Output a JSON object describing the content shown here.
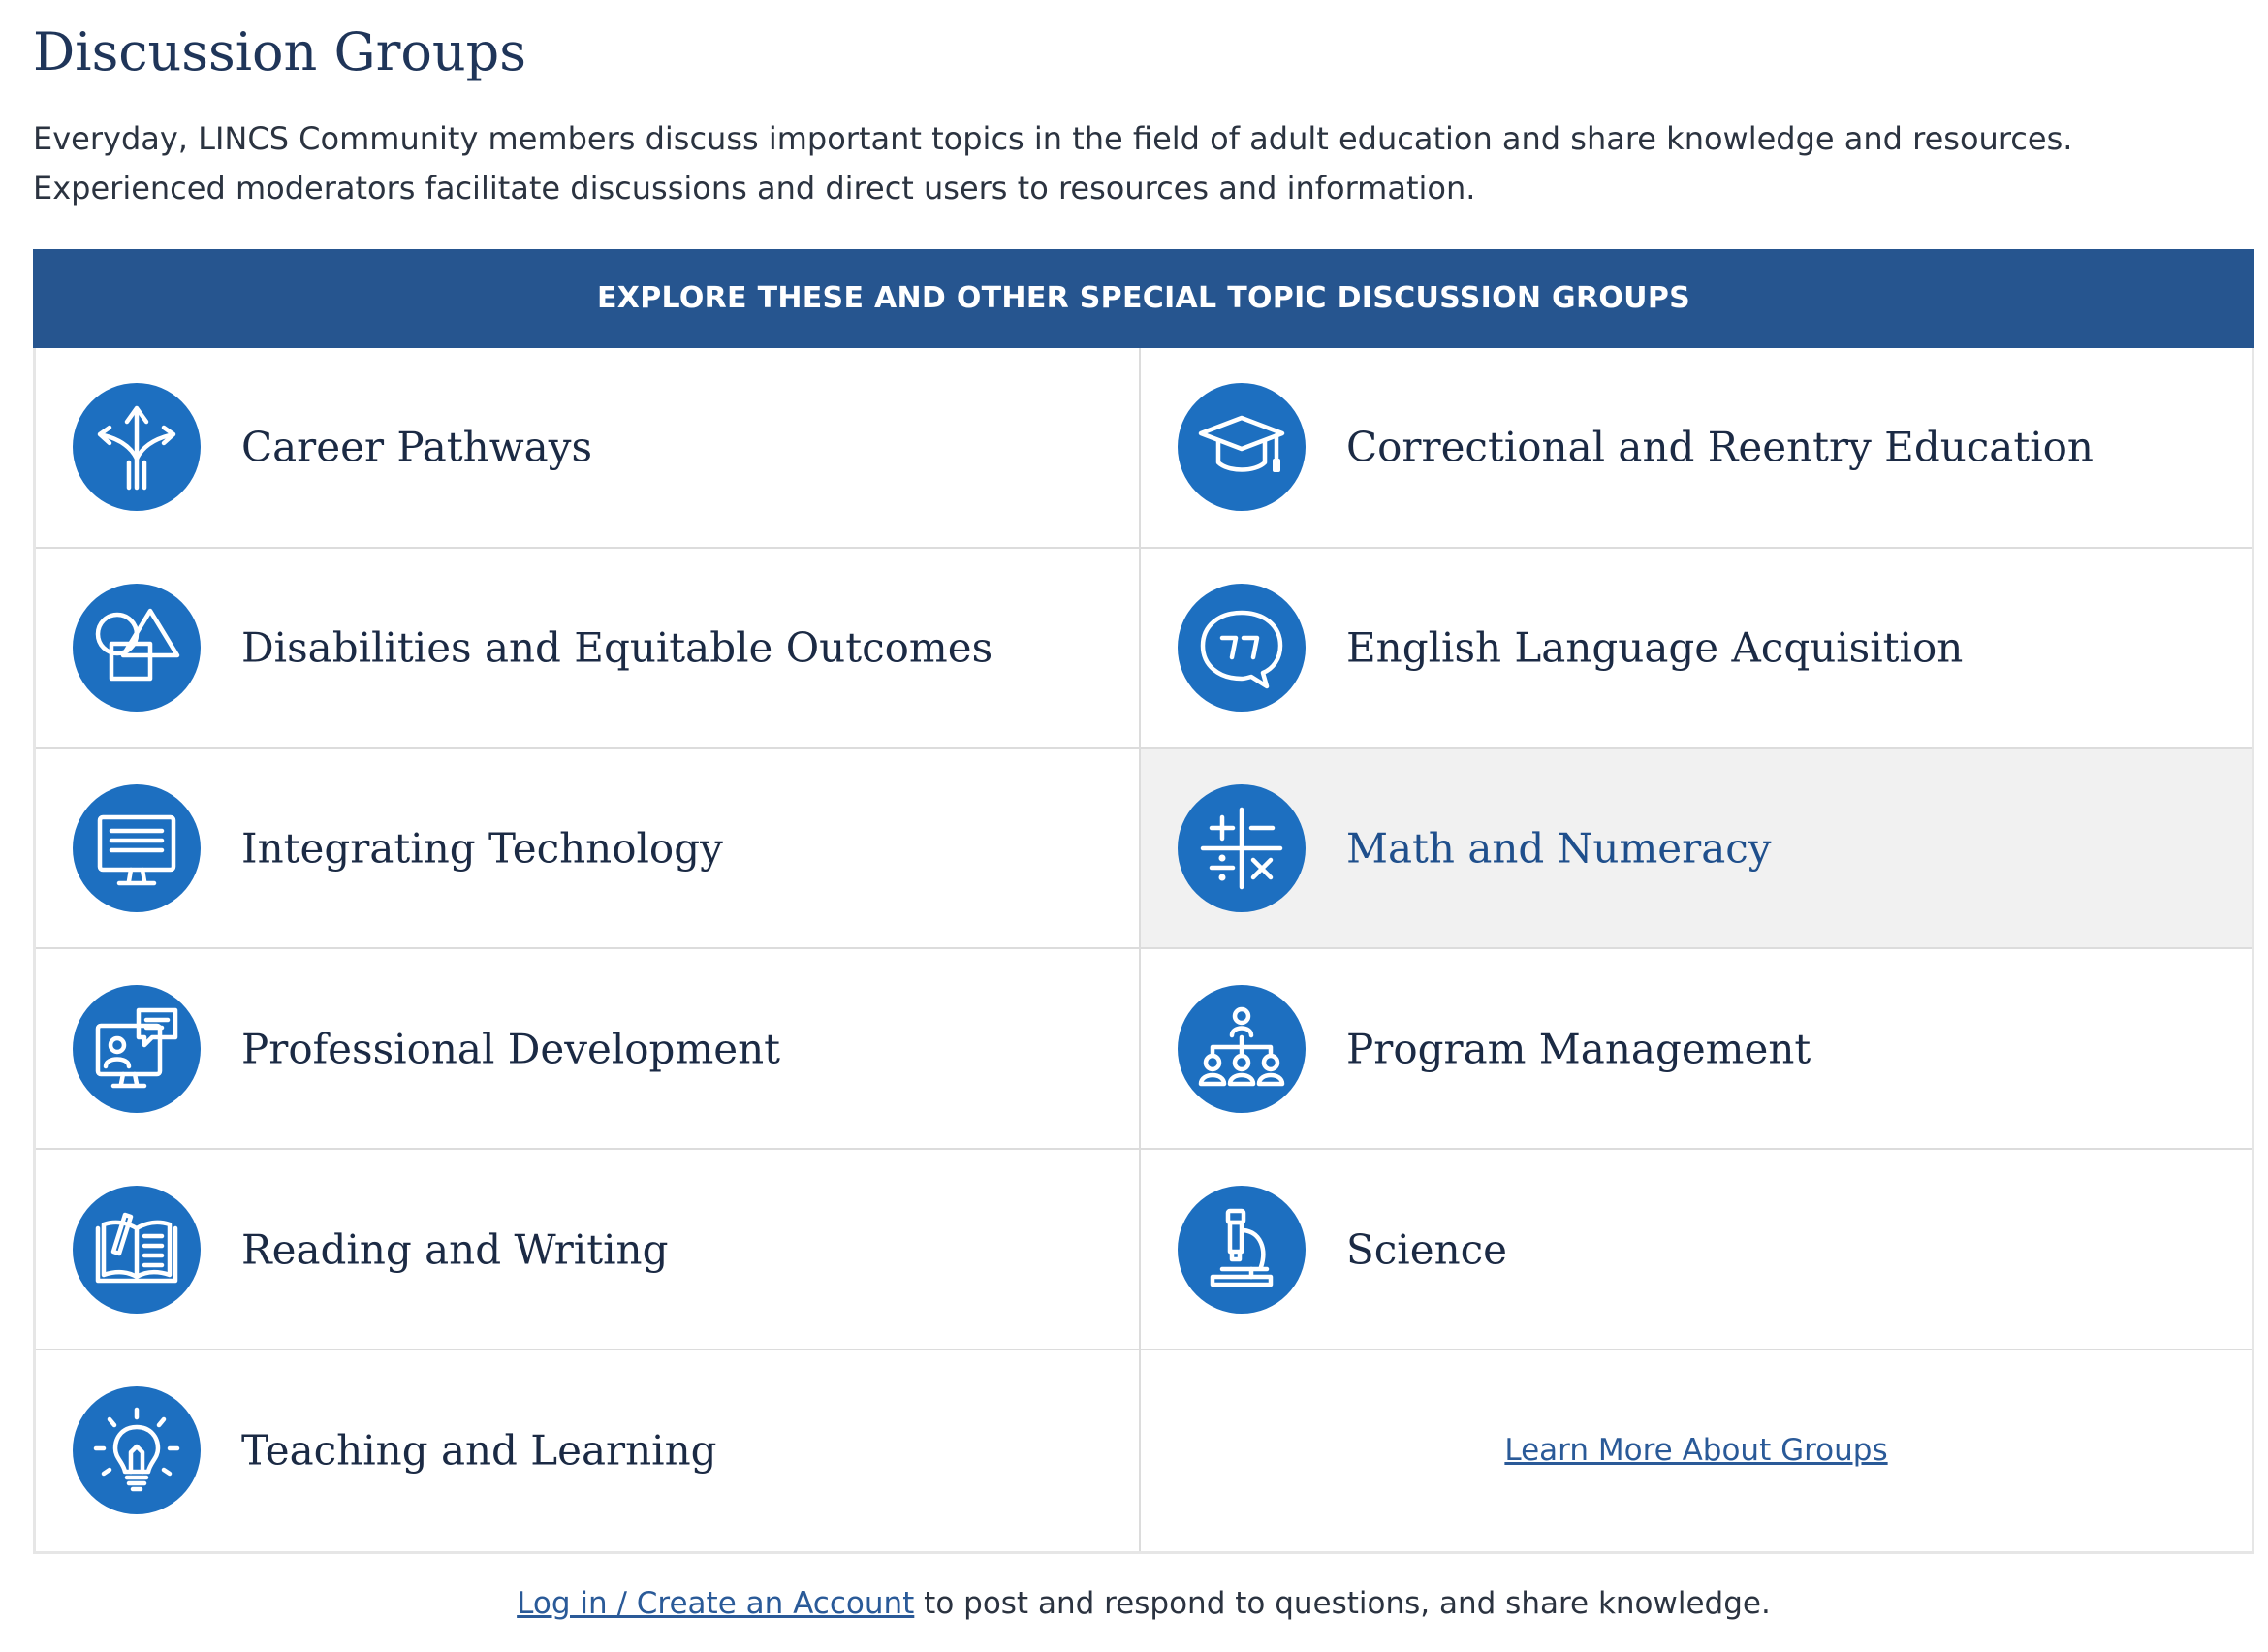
{
  "page": {
    "title": "Discussion Groups",
    "intro": "Everyday, LINCS Community members discuss important topics in the field of adult education and share knowledge and resources. Experienced moderators facilitate discussions and direct users to resources and information."
  },
  "groups": {
    "header": "EXPLORE THESE AND OTHER SPECIAL TOPIC DISCUSSION GROUPS",
    "items": [
      {
        "label": "Career Pathways",
        "icon": "diverging-arrows-icon"
      },
      {
        "label": "Correctional and Reentry Education",
        "icon": "graduation-cap-icon"
      },
      {
        "label": "Disabilities and Equitable Outcomes",
        "icon": "shapes-icon"
      },
      {
        "label": "English Language Acquisition",
        "icon": "quote-speech-bubble-icon"
      },
      {
        "label": "Integrating Technology",
        "icon": "computer-monitor-icon"
      },
      {
        "label": "Math and Numeracy",
        "icon": "math-operators-icon"
      },
      {
        "label": "Professional Development",
        "icon": "video-conference-icon"
      },
      {
        "label": "Program Management",
        "icon": "org-chart-icon"
      },
      {
        "label": "Reading and Writing",
        "icon": "open-book-pencil-icon"
      },
      {
        "label": "Science",
        "icon": "microscope-icon"
      },
      {
        "label": "Teaching and Learning",
        "icon": "lightbulb-icon"
      }
    ],
    "learn_more": "Learn More About Groups"
  },
  "footer": {
    "link": "Log in / Create an Account",
    "text": " to post and respond to questions, and share knowledge."
  },
  "colors": {
    "header_bg": "#26558f",
    "icon_bg": "#1d6fc0",
    "link": "#2a5a98",
    "hover_bg": "#f1f1f1"
  }
}
